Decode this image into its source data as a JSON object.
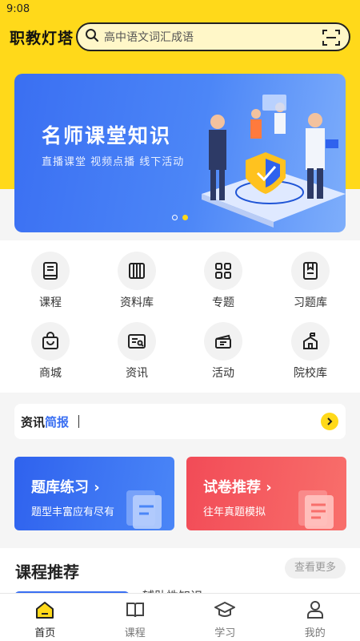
{
  "status_bar": {
    "time": "9:08"
  },
  "header": {
    "brand": "职教灯塔",
    "search_placeholder": "高中语文词汇成语"
  },
  "banner": {
    "title": "名师课堂知识",
    "subtitle": "直播课堂 视频点播 线下活动",
    "slide_index": 2,
    "slide_count": 2
  },
  "grid": [
    {
      "label": "课程",
      "icon": "book-icon"
    },
    {
      "label": "资料库",
      "icon": "library-icon"
    },
    {
      "label": "专题",
      "icon": "grid-icon"
    },
    {
      "label": "习题库",
      "icon": "exercise-book-icon"
    },
    {
      "label": "商城",
      "icon": "shopping-bag-icon"
    },
    {
      "label": "资讯",
      "icon": "news-icon"
    },
    {
      "label": "活动",
      "icon": "ticket-icon"
    },
    {
      "label": "院校库",
      "icon": "school-icon"
    }
  ],
  "news": {
    "label_a": "资讯",
    "label_b": "简报"
  },
  "cards": [
    {
      "title": "题库练习",
      "arrow": "›",
      "subtitle": "题型丰富应有尽有",
      "color": "#2f62ee"
    },
    {
      "title": "试卷推荐",
      "arrow": "›",
      "subtitle": "往年真题模拟",
      "color": "#f24b57"
    }
  ],
  "recommend": {
    "title": "课程推荐",
    "more": "查看更多",
    "item_text": "辅助性知识"
  },
  "tabbar": [
    {
      "label": "首页",
      "icon": "home-icon",
      "active": true
    },
    {
      "label": "课程",
      "icon": "course-book-icon",
      "active": false
    },
    {
      "label": "学习",
      "icon": "graduation-cap-icon",
      "active": false
    },
    {
      "label": "我的",
      "icon": "user-icon",
      "active": false
    }
  ],
  "colors": {
    "brand_yellow": "#ffd91a",
    "primary_blue": "#3a6ff2",
    "accent_red": "#f24b57"
  }
}
